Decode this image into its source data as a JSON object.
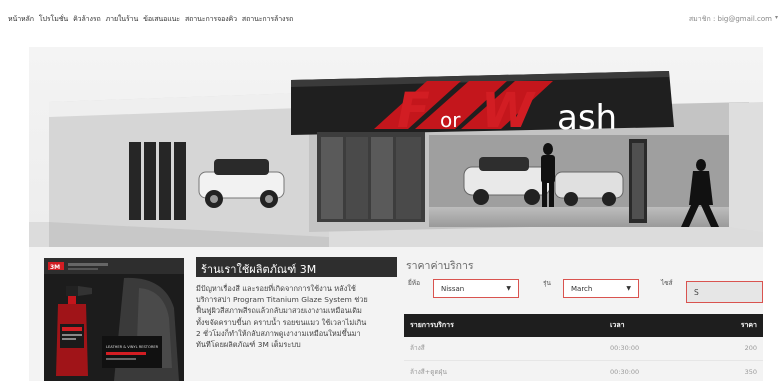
{
  "nav": {
    "items": [
      "หน้าหลัก",
      "โปรโมชั่น",
      "คิวล้างรถ",
      "ภายในร้าน",
      "ข้อเสนอแนะ",
      "สถานะการจองคิว",
      "สถานะการล้างรถ"
    ],
    "user_label": "สมาชิก : big@gmail.com"
  },
  "hero": {
    "brand_letters": [
      "F",
      "or",
      "W",
      "ash"
    ]
  },
  "promo": {
    "badge_text": "3M",
    "box_text": "LEATHER & VINYL RESTORER"
  },
  "info": {
    "heading": "ร้านเราใช้ผลิตภัณฑ์ 3M",
    "lines": [
      "มีปัญหาเรื่องสี และรอยที่เกิดจากการใช้งาน หลังใช้",
      "บริการสปา Program Titanium Glaze System ช่วย",
      "ฟื้นฟูผิวสีสภาพสีรถแล้วกลับมาสวยเงางามเหมือนเดิม",
      "ทั้งขจัดคราบขี้นก คราบน้ำ รอยขนแมว ใช้เวลาไม่เกิน",
      "2 ชั่วโมงก็ทำให้กลับสภาพดูเงางามเหมือนใหม่ขึ้นมา",
      "ทันทีโดยผลิตภัณฑ์ 3M เต็มระบบ"
    ]
  },
  "pricing": {
    "title": "ราคาค่าบริการ",
    "brand_label": "ยี่ห้อ",
    "brand_value": "Nissan",
    "model_label": "รุ่น",
    "model_value": "March",
    "size_label": "ไซส์",
    "size_value": "S",
    "table": {
      "headers": [
        "รายการบริการ",
        "เวลา",
        "ราคา"
      ],
      "rows": [
        [
          "ล้างสี",
          "00:30:00",
          "200"
        ],
        [
          "ล้างสี+ดูดฝุ่น",
          "00:30:00",
          "350"
        ]
      ]
    }
  },
  "colors": {
    "accent_red": "#d9534f",
    "table_header": "#1e1e1e",
    "heading_bg": "#2e2e2e"
  }
}
